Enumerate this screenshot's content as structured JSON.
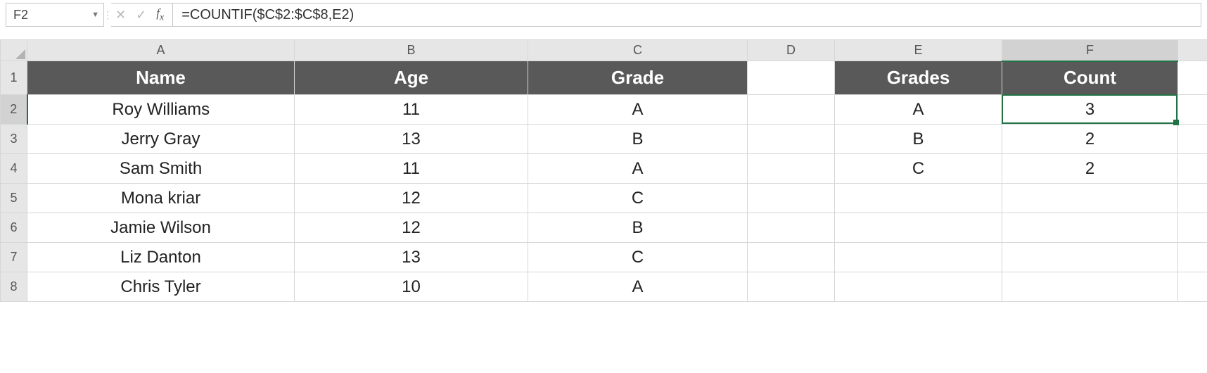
{
  "formula_bar": {
    "cell_ref": "F2",
    "formula": "=COUNTIF($C$2:$C$8,E2)"
  },
  "columns": {
    "A": "A",
    "B": "B",
    "C": "C",
    "D": "D",
    "E": "E",
    "F": "F"
  },
  "row_labels": {
    "r1": "1",
    "r2": "2",
    "r3": "3",
    "r4": "4",
    "r5": "5",
    "r6": "6",
    "r7": "7",
    "r8": "8"
  },
  "sheet_headers": {
    "A": "Name",
    "B": "Age",
    "C": "Grade",
    "D": "",
    "E": "Grades",
    "F": "Count"
  },
  "rows": [
    {
      "A": "Roy Williams",
      "B": "11",
      "C": "A",
      "D": "",
      "E": "A",
      "F": "3"
    },
    {
      "A": "Jerry Gray",
      "B": "13",
      "C": "B",
      "D": "",
      "E": "B",
      "F": "2"
    },
    {
      "A": "Sam Smith",
      "B": "11",
      "C": "A",
      "D": "",
      "E": "C",
      "F": "2"
    },
    {
      "A": "Mona kriar",
      "B": "12",
      "C": "C",
      "D": "",
      "E": "",
      "F": ""
    },
    {
      "A": "Jamie Wilson",
      "B": "12",
      "C": "B",
      "D": "",
      "E": "",
      "F": ""
    },
    {
      "A": "Liz Danton",
      "B": "13",
      "C": "C",
      "D": "",
      "E": "",
      "F": ""
    },
    {
      "A": "Chris Tyler",
      "B": "10",
      "C": "A",
      "D": "",
      "E": "",
      "F": ""
    }
  ],
  "active_cell": "F2"
}
